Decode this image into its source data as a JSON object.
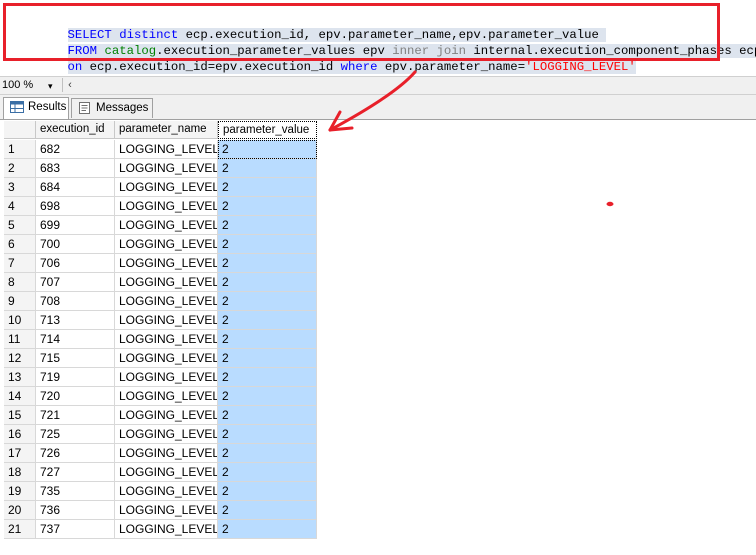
{
  "editor": {
    "line1": {
      "kw1": "SELECT",
      "kw2": "distinct",
      "text": " ecp.execution_id, epv.parameter_name,epv.parameter_value"
    },
    "line2": {
      "kw": "FROM",
      "sys": "catalog",
      "text1": ".execution_parameter_values epv ",
      "gray": "inner join",
      "text2": " internal.execution_component_phases ecp"
    },
    "line3": {
      "kw1": "on",
      "text1": " ecp.execution_id=epv.execution_id ",
      "kw2": "where",
      "text2": " epv.parameter_name=",
      "str": "'LOGGING_LEVEL'"
    }
  },
  "statusbar": {
    "zoom": "100 %",
    "zoom_arrow": "▾",
    "scroll_left": "‹"
  },
  "tabs": {
    "results": "Results",
    "messages": "Messages"
  },
  "grid": {
    "headers": [
      "execution_id",
      "parameter_name",
      "parameter_value"
    ],
    "rows": [
      [
        "1",
        "682",
        "LOGGING_LEVEL",
        "2"
      ],
      [
        "2",
        "683",
        "LOGGING_LEVEL",
        "2"
      ],
      [
        "3",
        "684",
        "LOGGING_LEVEL",
        "2"
      ],
      [
        "4",
        "698",
        "LOGGING_LEVEL",
        "2"
      ],
      [
        "5",
        "699",
        "LOGGING_LEVEL",
        "2"
      ],
      [
        "6",
        "700",
        "LOGGING_LEVEL",
        "2"
      ],
      [
        "7",
        "706",
        "LOGGING_LEVEL",
        "2"
      ],
      [
        "8",
        "707",
        "LOGGING_LEVEL",
        "2"
      ],
      [
        "9",
        "708",
        "LOGGING_LEVEL",
        "2"
      ],
      [
        "10",
        "713",
        "LOGGING_LEVEL",
        "2"
      ],
      [
        "11",
        "714",
        "LOGGING_LEVEL",
        "2"
      ],
      [
        "12",
        "715",
        "LOGGING_LEVEL",
        "2"
      ],
      [
        "13",
        "719",
        "LOGGING_LEVEL",
        "2"
      ],
      [
        "14",
        "720",
        "LOGGING_LEVEL",
        "2"
      ],
      [
        "15",
        "721",
        "LOGGING_LEVEL",
        "2"
      ],
      [
        "16",
        "725",
        "LOGGING_LEVEL",
        "2"
      ],
      [
        "17",
        "726",
        "LOGGING_LEVEL",
        "2"
      ],
      [
        "18",
        "727",
        "LOGGING_LEVEL",
        "2"
      ],
      [
        "19",
        "735",
        "LOGGING_LEVEL",
        "2"
      ],
      [
        "20",
        "736",
        "LOGGING_LEVEL",
        "2"
      ],
      [
        "21",
        "737",
        "LOGGING_LEVEL",
        "2"
      ]
    ]
  },
  "colors": {
    "annotation_red": "#e8202a",
    "selected_column": "#b9dcff",
    "keyword_blue": "#0000ff"
  },
  "icons": {
    "results_tab": "grid-icon",
    "messages_tab": "messages-icon",
    "annotation": "red-arrow"
  }
}
